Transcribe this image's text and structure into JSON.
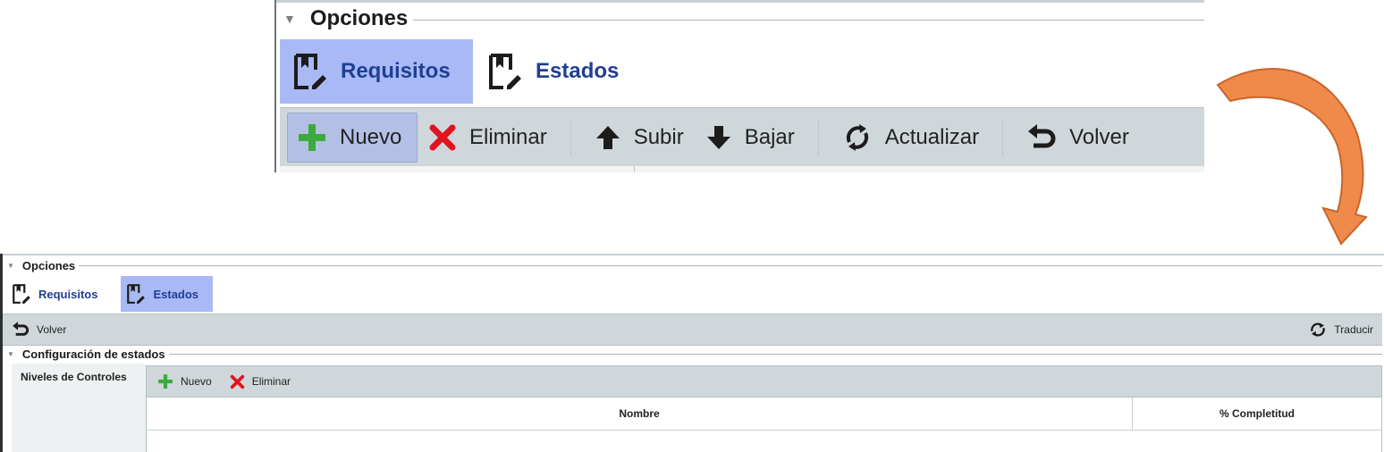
{
  "zoom": {
    "fieldset_title": "Opciones",
    "tabs": [
      {
        "label": "Requisitos",
        "icon": "bookmark-edit-icon",
        "active": true
      },
      {
        "label": "Estados",
        "icon": "bookmark-edit-icon",
        "active": false
      }
    ],
    "toolbar": {
      "nuevo": "Nuevo",
      "eliminar": "Eliminar",
      "subir": "Subir",
      "bajar": "Bajar",
      "actualizar": "Actualizar",
      "volver": "Volver"
    }
  },
  "screen": {
    "fieldset_title": "Opciones",
    "tabs": [
      {
        "label": "Requisitos",
        "icon": "bookmark-edit-icon",
        "active": false
      },
      {
        "label": "Estados",
        "icon": "bookmark-edit-icon",
        "active": true
      }
    ],
    "toolbar": {
      "volver": "Volver",
      "traducir": "Traducir"
    },
    "config_title": "Configuración de estados",
    "niveles_label": "Niveles de Controles",
    "grid_toolbar": {
      "nuevo": "Nuevo",
      "eliminar": "Eliminar"
    },
    "columns": [
      "Nombre",
      "% Completitud"
    ]
  },
  "colors": {
    "active_tab": "#a9b9f5",
    "toolbar_bg": "#d0d7da",
    "tab_text": "#1f3f94",
    "add_green": "#3daa3d",
    "delete_red": "#e0141e",
    "arrow_orange": "#f08a4b"
  }
}
